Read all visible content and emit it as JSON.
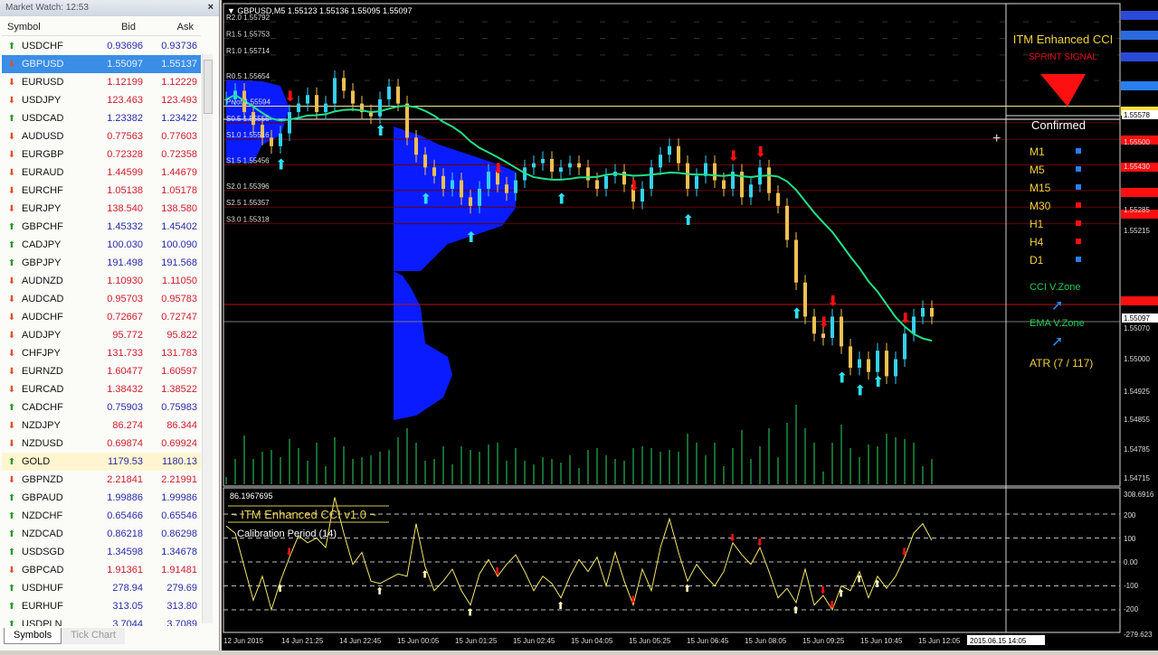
{
  "market_watch": {
    "title": "Market Watch: 12:53",
    "close_label": "×",
    "headers": {
      "symbol": "Symbol",
      "bid": "Bid",
      "ask": "Ask"
    },
    "rows": [
      {
        "symbol": "USDCHF",
        "bid": "0.93696",
        "ask": "0.93736",
        "dir": "up"
      },
      {
        "symbol": "GBPUSD",
        "bid": "1.55097",
        "ask": "1.55137",
        "dir": "dn",
        "selected": true
      },
      {
        "symbol": "EURUSD",
        "bid": "1.12199",
        "ask": "1.12229",
        "dir": "dn"
      },
      {
        "symbol": "USDJPY",
        "bid": "123.463",
        "ask": "123.493",
        "dir": "dn"
      },
      {
        "symbol": "USDCAD",
        "bid": "1.23382",
        "ask": "1.23422",
        "dir": "up"
      },
      {
        "symbol": "AUDUSD",
        "bid": "0.77563",
        "ask": "0.77603",
        "dir": "dn"
      },
      {
        "symbol": "EURGBP",
        "bid": "0.72328",
        "ask": "0.72358",
        "dir": "dn"
      },
      {
        "symbol": "EURAUD",
        "bid": "1.44599",
        "ask": "1.44679",
        "dir": "dn"
      },
      {
        "symbol": "EURCHF",
        "bid": "1.05138",
        "ask": "1.05178",
        "dir": "dn"
      },
      {
        "symbol": "EURJPY",
        "bid": "138.540",
        "ask": "138.580",
        "dir": "dn"
      },
      {
        "symbol": "GBPCHF",
        "bid": "1.45332",
        "ask": "1.45402",
        "dir": "up"
      },
      {
        "symbol": "CADJPY",
        "bid": "100.030",
        "ask": "100.090",
        "dir": "up"
      },
      {
        "symbol": "GBPJPY",
        "bid": "191.498",
        "ask": "191.568",
        "dir": "up"
      },
      {
        "symbol": "AUDNZD",
        "bid": "1.10930",
        "ask": "1.11050",
        "dir": "dn"
      },
      {
        "symbol": "AUDCAD",
        "bid": "0.95703",
        "ask": "0.95783",
        "dir": "dn"
      },
      {
        "symbol": "AUDCHF",
        "bid": "0.72667",
        "ask": "0.72747",
        "dir": "dn"
      },
      {
        "symbol": "AUDJPY",
        "bid": "95.772",
        "ask": "95.822",
        "dir": "dn"
      },
      {
        "symbol": "CHFJPY",
        "bid": "131.733",
        "ask": "131.783",
        "dir": "dn"
      },
      {
        "symbol": "EURNZD",
        "bid": "1.60477",
        "ask": "1.60597",
        "dir": "dn"
      },
      {
        "symbol": "EURCAD",
        "bid": "1.38432",
        "ask": "1.38522",
        "dir": "dn"
      },
      {
        "symbol": "CADCHF",
        "bid": "0.75903",
        "ask": "0.75983",
        "dir": "up"
      },
      {
        "symbol": "NZDJPY",
        "bid": "86.274",
        "ask": "86.344",
        "dir": "dn"
      },
      {
        "symbol": "NZDUSD",
        "bid": "0.69874",
        "ask": "0.69924",
        "dir": "dn"
      },
      {
        "symbol": "GOLD",
        "bid": "1179.53",
        "ask": "1180.13",
        "dir": "up",
        "highlight": true
      },
      {
        "symbol": "GBPNZD",
        "bid": "2.21841",
        "ask": "2.21991",
        "dir": "dn"
      },
      {
        "symbol": "GBPAUD",
        "bid": "1.99886",
        "ask": "1.99986",
        "dir": "up"
      },
      {
        "symbol": "NZDCHF",
        "bid": "0.65466",
        "ask": "0.65546",
        "dir": "up"
      },
      {
        "symbol": "NZDCAD",
        "bid": "0.86218",
        "ask": "0.86298",
        "dir": "up"
      },
      {
        "symbol": "USDSGD",
        "bid": "1.34598",
        "ask": "1.34678",
        "dir": "up"
      },
      {
        "symbol": "GBPCAD",
        "bid": "1.91361",
        "ask": "1.91481",
        "dir": "dn"
      },
      {
        "symbol": "USDHUF",
        "bid": "278.94",
        "ask": "279.69",
        "dir": "up"
      },
      {
        "symbol": "EURHUF",
        "bid": "313.05",
        "ask": "313.80",
        "dir": "up"
      },
      {
        "symbol": "USDPLN",
        "bid": "3.7044",
        "ask": "3.7089",
        "dir": "up"
      }
    ],
    "tabs": [
      "Symbols",
      "Tick Chart"
    ]
  },
  "chart": {
    "header": "GBPUSD,M5  1.55123 1.55136 1.55095 1.55097",
    "pivots": [
      {
        "label": "R2.0 1.55792",
        "price": 1.55792
      },
      {
        "label": "R1.5 1.55753",
        "price": 1.55753
      },
      {
        "label": "R1.0 1.55714",
        "price": 1.55714
      },
      {
        "label": "R0.5 1.55654",
        "price": 1.55654
      },
      {
        "label": "Pivot 1.55594",
        "price": 1.55594
      },
      {
        "label": "S0.5 1.55555",
        "price": 1.55555
      },
      {
        "label": "S1.0 1.55516",
        "price": 1.55516
      },
      {
        "label": "S1.5 1.55456",
        "price": 1.55456
      },
      {
        "label": "S2.0 1.55396",
        "price": 1.55396
      },
      {
        "label": "S2.5 1.55357",
        "price": 1.55357
      },
      {
        "label": "S3.0 1.55318",
        "price": 1.55318
      }
    ],
    "price_axis": [
      "1.55578",
      "1.55500",
      "1.55430",
      "1.55285",
      "1.55215",
      "1.55097",
      "1.55070",
      "1.55000",
      "1.54925",
      "1.54855",
      "1.54785",
      "1.54715"
    ],
    "cci_axis": [
      "308.6916",
      "200",
      "100",
      "0.00",
      "-100",
      "-200",
      "-279.623"
    ],
    "time_axis": [
      "12 Jun 2015",
      "14 Jun 21:25",
      "14 Jun 22:45",
      "15 Jun 00:05",
      "15 Jun 01:25",
      "15 Jun 02:45",
      "15 Jun 04:05",
      "15 Jun 05:25",
      "15 Jun 06:45",
      "15 Jun 08:05",
      "15 Jun 09:25",
      "15 Jun 10:45",
      "15 Jun 12:05"
    ],
    "time_cursor": "2015.06.15 14:05",
    "cci_value": "86.1967695",
    "cci_title": "~ ITM Enhanced CCI v1.0 ~",
    "cci_period": "Calibration Period (14)",
    "panel": {
      "title": "ITM Enhanced CCI",
      "signal": "SPRINT SIGNAL",
      "confirmed": "Confirmed",
      "timeframes": [
        {
          "tf": "M1",
          "color": "#2a7ff0"
        },
        {
          "tf": "M5",
          "color": "#2a7ff0"
        },
        {
          "tf": "M15",
          "color": "#2a7ff0"
        },
        {
          "tf": "M30",
          "color": "#ff1010"
        },
        {
          "tf": "H1",
          "color": "#ff1010"
        },
        {
          "tf": "H4",
          "color": "#ff1010"
        },
        {
          "tf": "D1",
          "color": "#2a7ff0"
        }
      ],
      "cci_zone": "CCI V.Zone",
      "ema_zone": "EMA V.Zone",
      "atr": "ATR (7 / 117)"
    }
  },
  "chart_data": {
    "type": "line",
    "title": "GBPUSD,M5",
    "ylim": [
      1.54715,
      1.55578
    ],
    "closes": [
      1.5561,
      1.5563,
      1.5558,
      1.5555,
      1.5552,
      1.555,
      1.5553,
      1.5558,
      1.556,
      1.5562,
      1.5558,
      1.556,
      1.5566,
      1.5563,
      1.556,
      1.5558,
      1.5557,
      1.5561,
      1.5564,
      1.556,
      1.5552,
      1.5548,
      1.5545,
      1.5543,
      1.554,
      1.5542,
      1.5538,
      1.5536,
      1.554,
      1.5544,
      1.5541,
      1.5539,
      1.5542,
      1.5545,
      1.5546,
      1.5547,
      1.5544,
      1.5545,
      1.5546,
      1.5545,
      1.5542,
      1.554,
      1.5543,
      1.5544,
      1.5541,
      1.5537,
      1.554,
      1.5545,
      1.5548,
      1.555,
      1.5546,
      1.554,
      1.5543,
      1.5546,
      1.5542,
      1.554,
      1.5544,
      1.5538,
      1.5541,
      1.5545,
      1.5539,
      1.5536,
      1.5528,
      1.5518,
      1.551,
      1.5506,
      1.5505,
      1.551,
      1.5503,
      1.5498,
      1.55,
      1.5497,
      1.5502,
      1.5496,
      1.55,
      1.5506,
      1.551,
      1.5512,
      1.551
    ],
    "cci": [
      150,
      120,
      -20,
      -160,
      -60,
      -200,
      -80,
      20,
      110,
      80,
      100,
      60,
      270,
      120,
      -10,
      40,
      -80,
      -90,
      -70,
      -50,
      -60,
      160,
      -20,
      -120,
      -80,
      -30,
      -120,
      -180,
      -50,
      10,
      -60,
      -10,
      30,
      -40,
      -120,
      -60,
      -90,
      -150,
      -60,
      10,
      -40,
      20,
      -100,
      40,
      -80,
      -180,
      -30,
      -120,
      60,
      180,
      40,
      -80,
      -10,
      -60,
      -100,
      -40,
      80,
      30,
      -10,
      60,
      -40,
      -150,
      -110,
      -170,
      -30,
      -180,
      -140,
      -200,
      -100,
      -120,
      -40,
      -150,
      -60,
      -110,
      -60,
      20,
      120,
      160,
      90
    ],
    "signals": [
      {
        "i": 6,
        "type": "up"
      },
      {
        "i": 17,
        "type": "up"
      },
      {
        "i": 7,
        "type": "down"
      },
      {
        "i": 22,
        "type": "up"
      },
      {
        "i": 27,
        "type": "up"
      },
      {
        "i": 30,
        "type": "down"
      },
      {
        "i": 37,
        "type": "up"
      },
      {
        "i": 45,
        "type": "down"
      },
      {
        "i": 51,
        "type": "up"
      },
      {
        "i": 56,
        "type": "down"
      },
      {
        "i": 59,
        "type": "down"
      },
      {
        "i": 63,
        "type": "up"
      },
      {
        "i": 66,
        "type": "down"
      },
      {
        "i": 67,
        "type": "down"
      },
      {
        "i": 68,
        "type": "up"
      },
      {
        "i": 70,
        "type": "up"
      },
      {
        "i": 72,
        "type": "up"
      },
      {
        "i": 75,
        "type": "down"
      }
    ]
  }
}
